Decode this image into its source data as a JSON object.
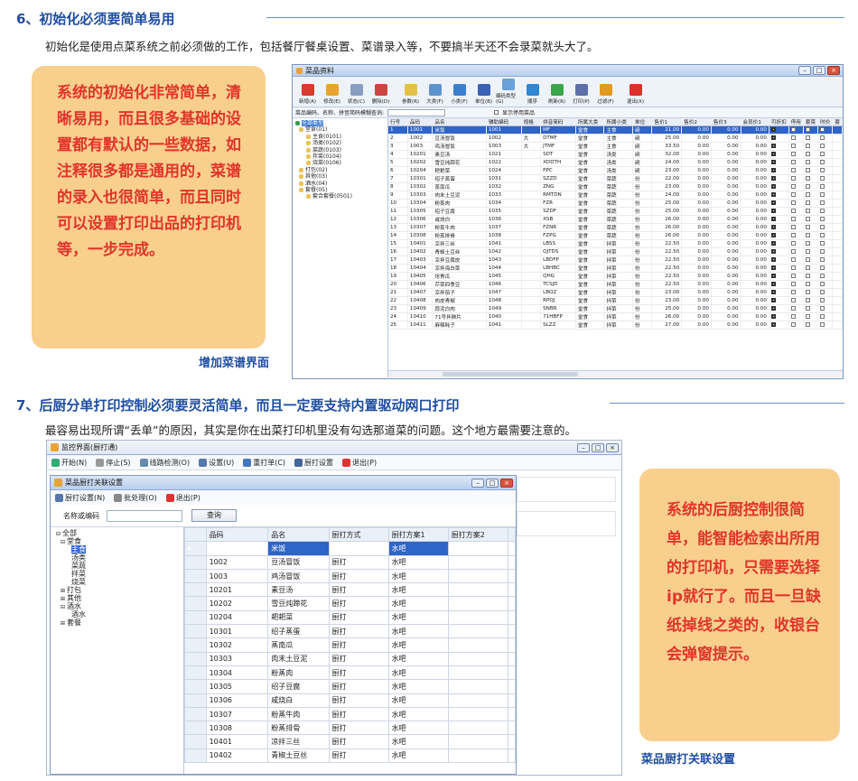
{
  "s1": {
    "title": "6、初始化必须要简单易用",
    "desc": "初始化是使用点菜系统之前必须做的工作，包括餐厅餐桌设置、菜谱录入等，不要搞半天还不会录菜就头大了。",
    "note": "系统的初始化非常简单，清晰易用，而且很多基础的设置都有默认的一些数据，如注释很多都是通用的，菜谱的录入也很简单，而且同时可以设置打印出品的打印机等，一步完成。",
    "caption": "增加菜谱界面"
  },
  "w1": {
    "title": "菜品资料",
    "tools": [
      {
        "label": "新增(A)",
        "color": "#d63b2e"
      },
      {
        "label": "修改(E)",
        "color": "#e7a52f"
      },
      {
        "label": "状态(C)",
        "color": "#8a9fc0"
      },
      {
        "label": "删除(D)",
        "color": "#c44"
      },
      {
        "label": "参数(R)",
        "color": "#e3c04a"
      },
      {
        "label": "大类(F)",
        "color": "#5b93cf"
      },
      {
        "label": "小类(F)",
        "color": "#3d7fcf"
      },
      {
        "label": "单位(B)",
        "color": "#3a62b5"
      },
      {
        "label": "编码类型(G)",
        "color": "#6aa0d8"
      },
      {
        "label": "顺序",
        "color": "#2f87d6"
      },
      {
        "label": "刷新(R)",
        "color": "#3aa54a"
      },
      {
        "label": "打印(P)",
        "color": "#5c6fa8"
      },
      {
        "label": "过滤(F)",
        "color": "#e39a22"
      },
      {
        "label": "退出(X)",
        "color": "#d9302a"
      }
    ],
    "search_label": "菜品编码、名称、拼音简码模糊查询:",
    "show_disabled": "显示停用菜品",
    "tree": [
      "全部类型",
      "堂食(01)",
      "主食(0101)",
      "汤类(0102)",
      "菜蔬(0103)",
      "拌菜(0104)",
      "烧菜(0106)",
      "打包(02)",
      "其他(03)",
      "酒水(04)",
      "套餐(05)",
      "套合套餐(0501)"
    ],
    "cols": [
      "行号",
      "品码",
      "品名",
      "辅助编码",
      "规格",
      "拼音简码",
      "所属大类",
      "所属小类",
      "单位",
      "售价1",
      "售价2",
      "售价3",
      "会员价1",
      "可折扣",
      "停用",
      "套菜",
      "时价",
      "套"
    ],
    "rows": [
      [
        "1",
        "1001",
        "米饭",
        "1001",
        "",
        "MF",
        "堂食",
        "主食",
        "碗",
        "21.00",
        "0.00",
        "0.00",
        "0.00",
        "1",
        "0",
        "0",
        "0"
      ],
      [
        "2",
        "1002",
        "豆汤冒饭",
        "1002",
        "大",
        "DTMF",
        "堂食",
        "主食",
        "碗",
        "25.00",
        "0.00",
        "0.00",
        "0.00",
        "1",
        "0",
        "0",
        "0"
      ],
      [
        "3",
        "1003",
        "鸡汤冒饭",
        "1003",
        "大",
        "JTMF",
        "堂食",
        "主食",
        "碗",
        "33.50",
        "0.00",
        "0.00",
        "0.00",
        "1",
        "0",
        "0",
        "0"
      ],
      [
        "4",
        "10201",
        "素豆汤",
        "1021",
        "",
        "SDT",
        "堂食",
        "汤类",
        "碗",
        "32.00",
        "0.00",
        "0.00",
        "0.00",
        "1",
        "0",
        "0",
        "0"
      ],
      [
        "5",
        "10202",
        "雪豆炖蹄花",
        "1022",
        "",
        "XDDTH",
        "堂食",
        "汤类",
        "碗",
        "24.00",
        "0.00",
        "0.00",
        "0.00",
        "1",
        "0",
        "0",
        "0"
      ],
      [
        "6",
        "10204",
        "耙耙菜",
        "1024",
        "",
        "PPC",
        "堂食",
        "汤类",
        "碗",
        "23.00",
        "0.00",
        "0.00",
        "0.00",
        "1",
        "0",
        "0",
        "0"
      ],
      [
        "7",
        "10301",
        "绍子蒸蛋",
        "1031",
        "",
        "SZZD",
        "堂食",
        "菜蔬",
        "份",
        "22.00",
        "0.00",
        "0.00",
        "0.00",
        "1",
        "0",
        "0",
        "0"
      ],
      [
        "8",
        "10302",
        "蒸南瓜",
        "1032",
        "",
        "ZNG",
        "堂食",
        "菜蔬",
        "份",
        "23.00",
        "0.00",
        "0.00",
        "0.00",
        "1",
        "0",
        "0",
        "0"
      ],
      [
        "9",
        "10303",
        "肉末土豆泥",
        "1033",
        "",
        "RMTDN",
        "堂食",
        "菜蔬",
        "份",
        "24.00",
        "0.00",
        "0.00",
        "0.00",
        "1",
        "0",
        "0",
        "0"
      ],
      [
        "10",
        "10304",
        "粉蒸肉",
        "1034",
        "",
        "FZR",
        "堂食",
        "菜蔬",
        "份",
        "25.00",
        "0.00",
        "0.00",
        "0.00",
        "1",
        "0",
        "0",
        "0"
      ],
      [
        "11",
        "10305",
        "绍子豆腐",
        "1035",
        "",
        "SZDF",
        "堂食",
        "菜蔬",
        "份",
        "25.00",
        "0.00",
        "0.00",
        "0.00",
        "1",
        "0",
        "0",
        "0"
      ],
      [
        "12",
        "10306",
        "咸烧白",
        "1036",
        "",
        "XSB",
        "堂食",
        "菜蔬",
        "份",
        "26.00",
        "0.00",
        "0.00",
        "0.00",
        "1",
        "0",
        "0",
        "0"
      ],
      [
        "13",
        "10307",
        "粉蒸牛肉",
        "1037",
        "",
        "FZNR",
        "堂食",
        "菜蔬",
        "份",
        "26.00",
        "0.00",
        "0.00",
        "0.00",
        "1",
        "0",
        "0",
        "0"
      ],
      [
        "14",
        "10308",
        "粉蒸排骨",
        "1038",
        "",
        "FZPG",
        "堂食",
        "菜蔬",
        "份",
        "26.00",
        "0.00",
        "0.00",
        "0.00",
        "1",
        "0",
        "0",
        "0"
      ],
      [
        "15",
        "10401",
        "凉拌三丝",
        "1041",
        "",
        "LBSS",
        "堂食",
        "拌菜",
        "份",
        "22.50",
        "0.00",
        "0.00",
        "0.00",
        "1",
        "0",
        "0",
        "0"
      ],
      [
        "16",
        "10402",
        "青椒土豆丝",
        "1042",
        "",
        "QJTDS",
        "堂食",
        "拌菜",
        "份",
        "22.50",
        "0.00",
        "0.00",
        "0.00",
        "1",
        "0",
        "0",
        "0"
      ],
      [
        "17",
        "10403",
        "凉拌豆腐皮",
        "1043",
        "",
        "LBDFP",
        "堂食",
        "拌菜",
        "份",
        "22.50",
        "0.00",
        "0.00",
        "0.00",
        "1",
        "0",
        "0",
        "0"
      ],
      [
        "18",
        "10404",
        "凉拌海白菜",
        "1044",
        "",
        "LBHBC",
        "堂食",
        "拌菜",
        "份",
        "22.50",
        "0.00",
        "0.00",
        "0.00",
        "1",
        "0",
        "0",
        "0"
      ],
      [
        "19",
        "10405",
        "炝青瓜",
        "1045",
        "",
        "QHG",
        "堂食",
        "拌菜",
        "份",
        "22.50",
        "0.00",
        "0.00",
        "0.00",
        "1",
        "0",
        "0",
        "0"
      ],
      [
        "20",
        "10406",
        "芹菜四季豆",
        "1046",
        "",
        "TCSJD",
        "堂食",
        "拌菜",
        "份",
        "22.50",
        "0.00",
        "0.00",
        "0.00",
        "1",
        "0",
        "0",
        "0"
      ],
      [
        "21",
        "10407",
        "凉拌茄子",
        "1047",
        "",
        "LBQZ",
        "堂食",
        "拌菜",
        "份",
        "23.00",
        "0.00",
        "0.00",
        "0.00",
        "1",
        "0",
        "0",
        "0"
      ],
      [
        "22",
        "10408",
        "肉皮青椒",
        "1048",
        "",
        "RPQJ",
        "堂食",
        "拌菜",
        "份",
        "23.00",
        "0.00",
        "0.00",
        "0.00",
        "1",
        "0",
        "0",
        "0"
      ],
      [
        "23",
        "10409",
        "蒜泥白肉",
        "1049",
        "",
        "SNBR",
        "堂食",
        "拌菜",
        "份",
        "25.00",
        "0.00",
        "0.00",
        "0.00",
        "1",
        "0",
        "0",
        "0"
      ],
      [
        "24",
        "10410",
        "71号拌肺片",
        "1040",
        "",
        "71HBFP",
        "堂食",
        "拌菜",
        "份",
        "26.00",
        "0.00",
        "0.00",
        "0.00",
        "1",
        "0",
        "0",
        "0"
      ],
      [
        "25",
        "10411",
        "麻辣耗子",
        "1041",
        "",
        "SLZZ",
        "堂食",
        "拌菜",
        "份",
        "27.00",
        "0.00",
        "0.00",
        "0.00",
        "1",
        "0",
        "0",
        "0"
      ]
    ]
  },
  "s2": {
    "title": "7、后厨分单打印控制必须要灵活简单，而且一定要支持内置驱动网口打印",
    "desc": "最容易出现所谓“丢单”的原因，其实是你在出菜打印机里没有勾选那道菜的问题。这个地方最需要注意的。",
    "note": "系统的后厨控制很简单，能智能检索出所用的打印机，只需要选择ip就行了。而且一旦缺纸掉线之类的，收银台会弹窗提示。",
    "caption": "菜品厨打关联设置"
  },
  "w2": {
    "title": "监控界面(厨打通)",
    "menu": [
      {
        "label": "开始(N)",
        "color": "#3a7"
      },
      {
        "label": "停止(S)",
        "color": "#999"
      },
      {
        "label": "线路检测(O)",
        "color": "#68a"
      },
      {
        "label": "设置(U)",
        "color": "#57a"
      },
      {
        "label": "重打单(C)",
        "color": "#47b"
      },
      {
        "label": "厨打设置",
        "color": "#469"
      },
      {
        "label": "退出(P)",
        "color": "#d33"
      }
    ]
  },
  "w3": {
    "title": "菜品厨打关联设置",
    "menu": [
      {
        "label": "厨打设置(N)",
        "color": "#57a"
      },
      {
        "label": "批处理(O)",
        "color": "#888"
      },
      {
        "label": "退出(P)",
        "color": "#d33"
      }
    ],
    "search_label": "名称或编码",
    "query_btn": "查询",
    "tree": [
      "全部",
      "堂食",
      "主食",
      "汤类",
      "菜蔬",
      "拌菜",
      "烧菜",
      "打包",
      "其他",
      "酒水",
      "酒水",
      "套餐"
    ],
    "cols": [
      "品码",
      "品名",
      "厨打方式",
      "厨打方案1",
      "厨打方案2"
    ],
    "rows": [
      [
        "1001",
        "米饭",
        "厨打",
        "水吧"
      ],
      [
        "1002",
        "豆汤冒饭",
        "厨打",
        "水吧"
      ],
      [
        "1003",
        "鸡汤冒饭",
        "厨打",
        "水吧"
      ],
      [
        "10201",
        "素豆汤",
        "厨打",
        "水吧"
      ],
      [
        "10202",
        "雪豆炖蹄花",
        "厨打",
        "水吧"
      ],
      [
        "10204",
        "耙耙菜",
        "厨打",
        "水吧"
      ],
      [
        "10301",
        "绍子蒸蛋",
        "厨打",
        "水吧"
      ],
      [
        "10302",
        "蒸南瓜",
        "厨打",
        "水吧"
      ],
      [
        "10303",
        "肉末土豆泥",
        "厨打",
        "水吧"
      ],
      [
        "10304",
        "粉蒸肉",
        "厨打",
        "水吧"
      ],
      [
        "10305",
        "绍子豆腐",
        "厨打",
        "水吧"
      ],
      [
        "10306",
        "咸烧白",
        "厨打",
        "水吧"
      ],
      [
        "10307",
        "粉蒸牛肉",
        "厨打",
        "水吧"
      ],
      [
        "10308",
        "粉蒸排骨",
        "厨打",
        "水吧"
      ],
      [
        "10401",
        "凉拌三丝",
        "厨打",
        "水吧"
      ],
      [
        "10402",
        "青椒土豆丝",
        "厨打",
        "水吧"
      ]
    ]
  }
}
